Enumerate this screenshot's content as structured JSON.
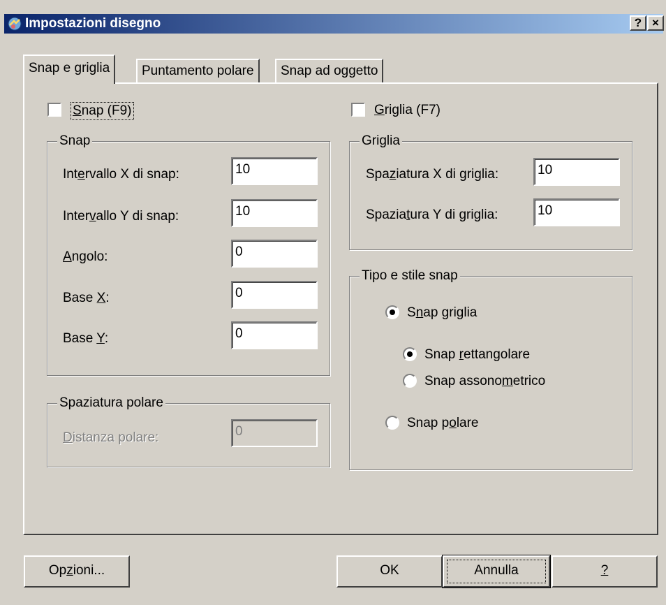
{
  "window": {
    "title": "Impostazioni disegno",
    "help_btn": "?",
    "close_btn": "×"
  },
  "tabs": [
    "Snap e griglia",
    "Puntamento polare",
    "Snap ad oggetto"
  ],
  "snap_toggle": {
    "label": "Snap (F9)",
    "checked": false
  },
  "grid_toggle": {
    "label": "Griglia (F7)",
    "checked": false
  },
  "snap_group": {
    "title": "Snap",
    "rows": [
      {
        "label": "Intervallo X di snap:",
        "value": "10"
      },
      {
        "label": "Intervallo Y di snap:",
        "value": "10"
      },
      {
        "label": "Angolo:",
        "value": "0"
      },
      {
        "label": "Base X:",
        "value": "0"
      },
      {
        "label": "Base Y:",
        "value": "0"
      }
    ]
  },
  "polar_group": {
    "title": "Spaziatura polare",
    "label": "Distanza polare:",
    "value": "0"
  },
  "grid_group": {
    "title": "Griglia",
    "rows": [
      {
        "label": "Spaziatura X di griglia:",
        "value": "10"
      },
      {
        "label": "Spaziatura Y di griglia:",
        "value": "10"
      }
    ]
  },
  "type_group": {
    "title": "Tipo e stile snap",
    "snap_grid": "Snap griglia",
    "snap_rect": "Snap rettangolare",
    "snap_iso": "Snap assonometrico",
    "snap_polar": "Snap polare"
  },
  "buttons": {
    "options": "Opzioni...",
    "ok": "OK",
    "cancel": "Annulla",
    "help": "?"
  }
}
